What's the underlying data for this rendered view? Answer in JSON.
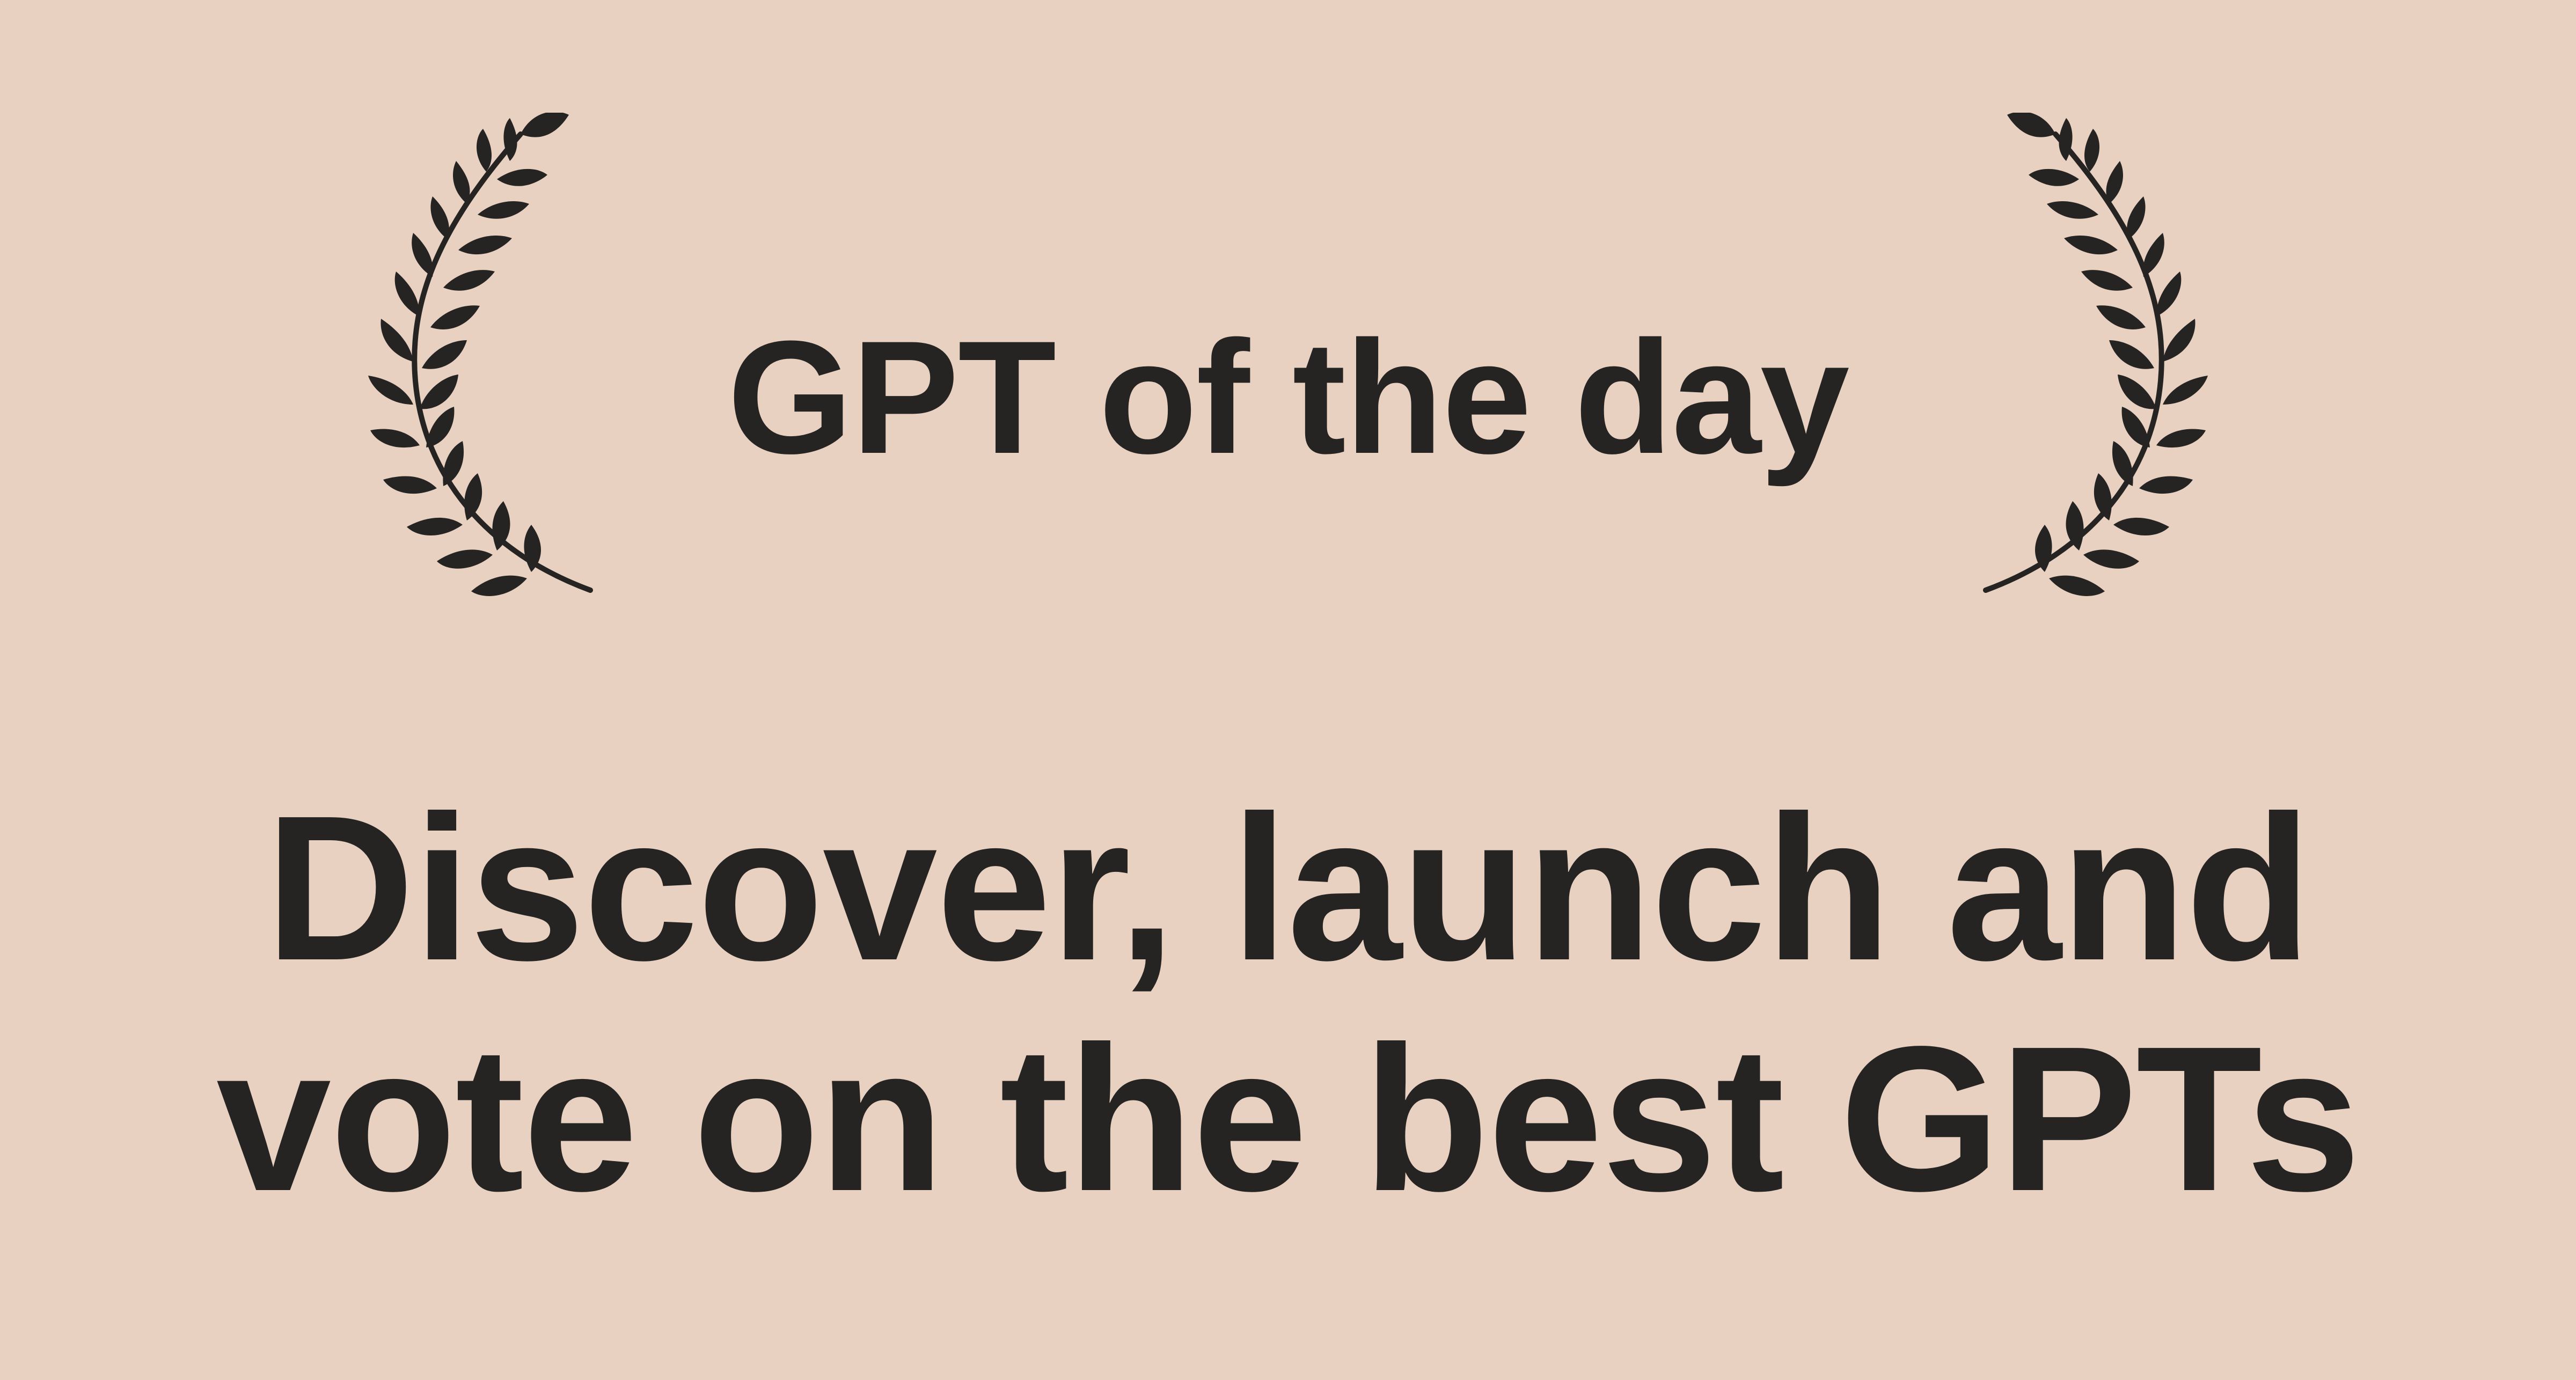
{
  "badge": {
    "title": "GPT of the day",
    "left_icon": "laurel-branch-icon",
    "right_icon": "laurel-branch-icon"
  },
  "tagline": {
    "line1": "Discover, launch and",
    "line2": "vote on the best GPTs"
  },
  "colors": {
    "background": "#e8d1c0",
    "text": "#252423"
  }
}
